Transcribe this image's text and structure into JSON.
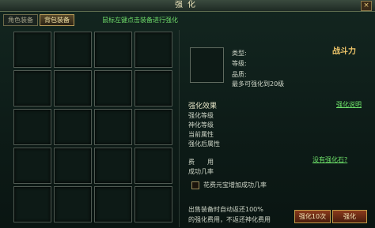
{
  "window": {
    "title": "强化",
    "close_icon": "close-icon"
  },
  "tabs": [
    {
      "label": "角色装备"
    },
    {
      "label": "背包装备"
    }
  ],
  "hint_text": "鼠标左键点击装备进行强化",
  "item_info": {
    "power_label": "战斗力",
    "type_label": "类型:",
    "level_label": "等级:",
    "quality_label": "品质:",
    "max_enhance": "最多可强化到20级"
  },
  "effects": {
    "header": "强化效果",
    "help_link": "强化说明",
    "rows": [
      "强化等级",
      "神化等级",
      "当前属性",
      "强化后属性"
    ]
  },
  "cost": {
    "cost_label": "费　　用",
    "success_label": "成功几率",
    "no_stone_link": "没有强化石?",
    "checkbox_label": "花费元宝增加成功几率"
  },
  "footer": {
    "note_line1": "出售装备时自动返还100%",
    "note_line2": "的强化费用，不返还神化费用",
    "btn_left": "强化10次",
    "btn_right": "强化"
  }
}
